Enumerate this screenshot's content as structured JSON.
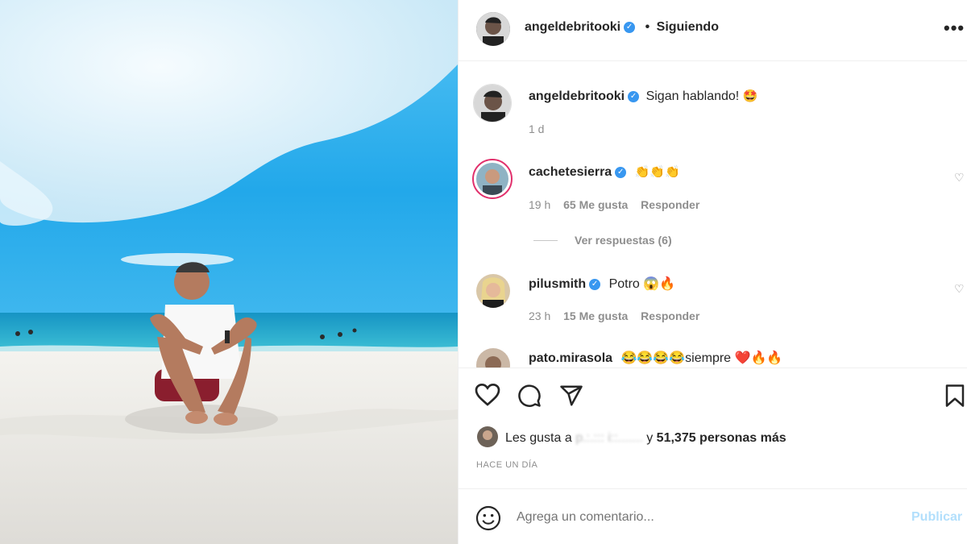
{
  "header": {
    "username": "angeldebritooki",
    "separator": "•",
    "follow_label": "Siguiendo",
    "more_icon": "more-horizontal-icon",
    "more_label": "•••"
  },
  "caption": {
    "username": "angeldebritooki",
    "text": "Sigan hablando!",
    "emoji": "🤩",
    "time": "1 d"
  },
  "comments": [
    {
      "username": "cachetesierra",
      "text": "👏👏👏",
      "time": "19 h",
      "likes": "65 Me gusta",
      "reply": "Responder",
      "view_replies": "Ver respuestas (6)"
    },
    {
      "username": "pilusmith",
      "text": "Potro 😱🔥",
      "time": "23 h",
      "likes": "15 Me gusta",
      "reply": "Responder"
    },
    {
      "username": "pato.mirasola",
      "text": "😂😂😂😂siempre ❤️🔥🔥"
    }
  ],
  "actions": {
    "like_icon": "heart-icon",
    "comment_icon": "comment-icon",
    "share_icon": "send-icon",
    "save_icon": "bookmark-icon"
  },
  "likes_summary": {
    "prefix": "Les gusta a",
    "blurred_name": "p.:.::: i::.......",
    "connector": "y",
    "count": "51,375 personas más"
  },
  "post_time": "HACE UN DÍA",
  "add_comment": {
    "emoji_icon": "smiley-icon",
    "placeholder": "Agrega un comentario...",
    "publish_label": "Publicar"
  },
  "colors": {
    "verified": "#3897f0",
    "sky": "#2aa6e6",
    "sea": "#1fa6c8",
    "sand": "#f1f1ef"
  }
}
